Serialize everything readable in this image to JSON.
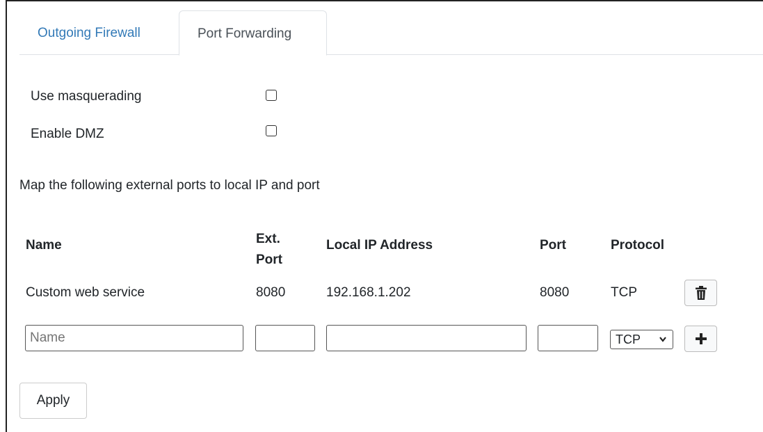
{
  "tabs": [
    {
      "label": "Outgoing Firewall",
      "active": false
    },
    {
      "label": "Port Forwarding",
      "active": true
    }
  ],
  "options": {
    "masquerading": {
      "label": "Use masquerading",
      "checked": false
    },
    "dmz": {
      "label": "Enable DMZ",
      "checked": false
    }
  },
  "intro_text": "Map the following external ports to local IP and port",
  "table": {
    "headers": {
      "name": "Name",
      "ext_port_line1": "Ext.",
      "ext_port_line2": "Port",
      "local_ip": "Local IP Address",
      "port": "Port",
      "protocol": "Protocol"
    },
    "rows": [
      {
        "name": "Custom web service",
        "ext_port": "8080",
        "local_ip": "192.168.1.202",
        "port": "8080",
        "protocol": "TCP"
      }
    ],
    "new_row": {
      "name_placeholder": "Name",
      "ext_port": "",
      "local_ip": "",
      "port": "",
      "protocol_selected": "TCP"
    }
  },
  "icons": {
    "delete": "trash-icon",
    "add": "plus-icon",
    "dropdown": "chevron-down-icon"
  },
  "apply_label": "Apply",
  "colors": {
    "tab_link": "#337ab7",
    "border": "#dee2e6"
  }
}
